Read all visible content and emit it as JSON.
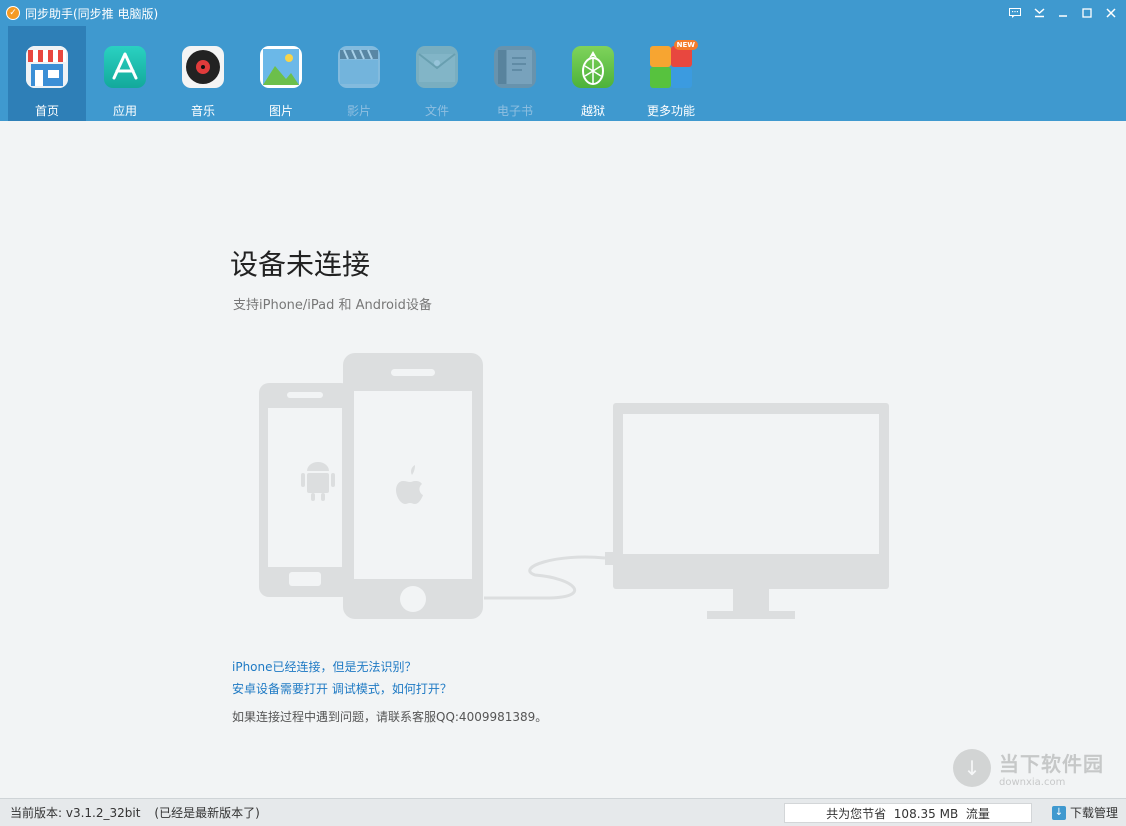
{
  "window": {
    "title": "同步助手(同步推 电脑版)",
    "controls": [
      "feedback-icon",
      "menu-icon",
      "minimize-icon",
      "maximize-icon",
      "close-icon"
    ]
  },
  "toolbar": {
    "items": [
      {
        "label": "首页",
        "icon": "home-store-icon",
        "active": true
      },
      {
        "label": "应用",
        "icon": "app-store-icon"
      },
      {
        "label": "音乐",
        "icon": "music-disc-icon"
      },
      {
        "label": "图片",
        "icon": "picture-icon"
      },
      {
        "label": "影片",
        "icon": "video-clapper-icon",
        "disabled": true
      },
      {
        "label": "文件",
        "icon": "file-folder-icon",
        "disabled": true
      },
      {
        "label": "电子书",
        "icon": "ebook-icon",
        "disabled": true
      },
      {
        "label": "越狱",
        "icon": "pineapple-icon"
      },
      {
        "label": "更多功能",
        "icon": "more-features-icon",
        "badge": "NEW"
      }
    ]
  },
  "main": {
    "heading": "设备未连接",
    "subheading": "支持iPhone/iPad 和 Android设备",
    "link_iphone": "iPhone已经连接，但是无法识别？",
    "link_android": "安卓设备需要打开 调试模式，如何打开？",
    "contact": "如果连接过程中遇到问题，请联系客服QQ:4009981389。"
  },
  "watermark": {
    "main": "当下软件园",
    "sub": "downxia.com"
  },
  "status": {
    "version": "当前版本: v3.1.2_32bit",
    "version_note": "(已经是最新版本了)",
    "traffic": "共为您节省  108.35 MB  流量",
    "download_manager": "下载管理"
  },
  "colors": {
    "titlebar": "#3f99cf",
    "active_tab": "#2e7fb7",
    "link": "#1f7ac4",
    "illustration": "#dcdedf"
  }
}
